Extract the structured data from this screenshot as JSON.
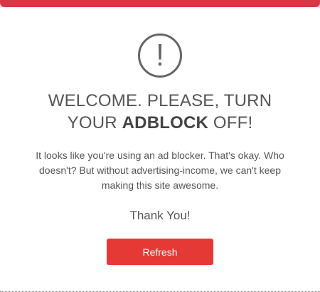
{
  "modal": {
    "accent_color": "#dc3545",
    "icon": {
      "name": "exclamation-icon",
      "glyph": "!"
    },
    "headline": {
      "line1": "WELCOME. PLEASE, TURN",
      "line2_prefix": "YOUR",
      "line2_strong": "ADBLOCK",
      "line2_suffix": "OFF!"
    },
    "body": "It looks like you're using an ad blocker. That's okay. Who doesn't? But without advertising-income, we can't keep making this site awesome.",
    "thanks": "Thank You!",
    "refresh_label": "Refresh",
    "button_color": "#e53935"
  }
}
